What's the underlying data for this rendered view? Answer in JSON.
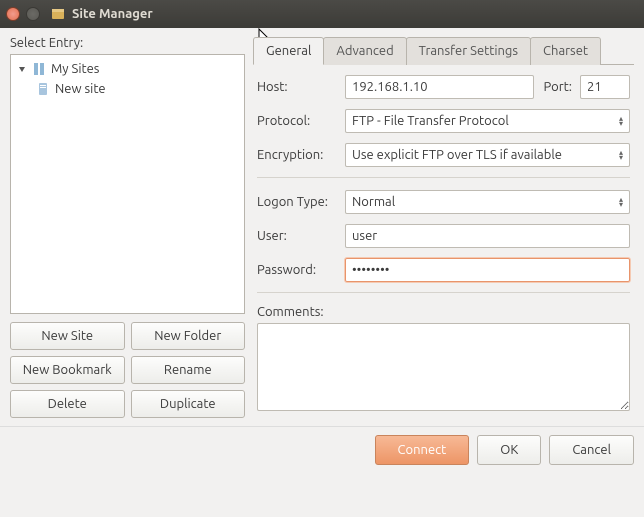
{
  "window": {
    "title": "Site Manager"
  },
  "left": {
    "select_label": "Select Entry:",
    "tree": {
      "root": "My Sites",
      "item": "New site"
    },
    "buttons": {
      "new_site": "New Site",
      "new_folder": "New Folder",
      "new_bookmark": "New Bookmark",
      "rename": "Rename",
      "delete": "Delete",
      "duplicate": "Duplicate"
    }
  },
  "tabs": {
    "general": "General",
    "advanced": "Advanced",
    "transfer": "Transfer Settings",
    "charset": "Charset"
  },
  "form": {
    "host_label": "Host:",
    "host_value": "192.168.1.10",
    "port_label": "Port:",
    "port_value": "21",
    "protocol_label": "Protocol:",
    "protocol_value": "FTP - File Transfer Protocol",
    "encryption_label": "Encryption:",
    "encryption_value": "Use explicit FTP over TLS if available",
    "logon_label": "Logon Type:",
    "logon_value": "Normal",
    "user_label": "User:",
    "user_value": "user",
    "password_label": "Password:",
    "password_value": "••••••••",
    "comments_label": "Comments:"
  },
  "footer": {
    "connect": "Connect",
    "ok": "OK",
    "cancel": "Cancel"
  }
}
